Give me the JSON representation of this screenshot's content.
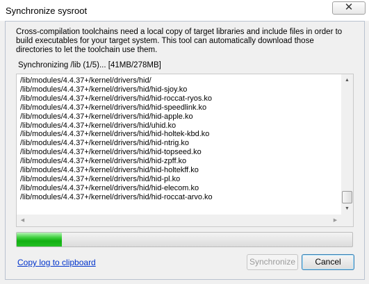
{
  "window": {
    "title": "Synchronize sysroot",
    "close_glyph": "✕"
  },
  "description": "Cross-compilation toolchains need a local copy of target libraries and include files in order to build executables for your target system. This tool can automatically download those directories to let the toolchain use them.",
  "status": {
    "text": "Synchronizing /lib (1/5)... [41MB/278MB]"
  },
  "log": {
    "lines": [
      "/lib/modules/4.4.37+/kernel/drivers/hid/",
      "/lib/modules/4.4.37+/kernel/drivers/hid/hid-sjoy.ko",
      "/lib/modules/4.4.37+/kernel/drivers/hid/hid-roccat-ryos.ko",
      "/lib/modules/4.4.37+/kernel/drivers/hid/hid-speedlink.ko",
      "/lib/modules/4.4.37+/kernel/drivers/hid/hid-apple.ko",
      "/lib/modules/4.4.37+/kernel/drivers/hid/uhid.ko",
      "/lib/modules/4.4.37+/kernel/drivers/hid/hid-holtek-kbd.ko",
      "/lib/modules/4.4.37+/kernel/drivers/hid/hid-ntrig.ko",
      "/lib/modules/4.4.37+/kernel/drivers/hid/hid-topseed.ko",
      "/lib/modules/4.4.37+/kernel/drivers/hid/hid-zpff.ko",
      "/lib/modules/4.4.37+/kernel/drivers/hid/hid-holtekff.ko",
      "/lib/modules/4.4.37+/kernel/drivers/hid/hid-pl.ko",
      "/lib/modules/4.4.37+/kernel/drivers/hid/hid-elecom.ko",
      "/lib/modules/4.4.37+/kernel/drivers/hid/hid-roccat-arvo.ko"
    ]
  },
  "progress": {
    "fraction": 0.135,
    "color": "#22c022"
  },
  "footer": {
    "copy_log_label": "Copy log to clipboard",
    "synchronize_label": "Synchronize",
    "cancel_label": "Cancel"
  },
  "icons": {
    "scroll_up": "▲",
    "scroll_down": "▼",
    "scroll_left": "◀",
    "scroll_right": "▶"
  }
}
